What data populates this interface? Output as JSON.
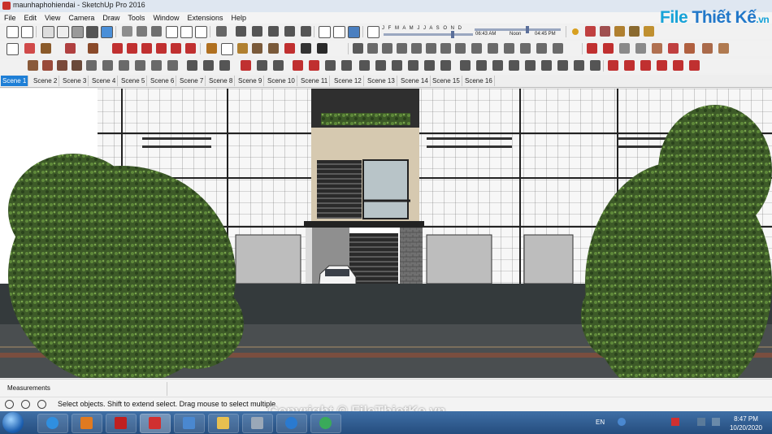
{
  "window": {
    "title": "maunhaphohiendai - SketchUp Pro 2016"
  },
  "menu": [
    "File",
    "Edit",
    "View",
    "Camera",
    "Draw",
    "Tools",
    "Window",
    "Extensions",
    "Help"
  ],
  "shadow_settings": {
    "months": "J F M A M J J A S O N D",
    "time_start": "06:43 AM",
    "time_mid": "Noon",
    "time_end": "04:45 PM",
    "date_fraction": 0.78,
    "time_fraction": 0.62
  },
  "logo": {
    "text_main": "File",
    "text_rest": "Thiết Kế",
    "text_tld": ".vn"
  },
  "scenes": {
    "active": 0,
    "items": [
      "Scene 1",
      "Scene 2",
      "Scene 3",
      "Scene 4",
      "Scene 5",
      "Scene 6",
      "Scene 7",
      "Scene 8",
      "Scene 9",
      "Scene 10",
      "Scene 11",
      "Scene 12",
      "Scene 13",
      "Scene 14",
      "Scene 15",
      "Scene 16"
    ]
  },
  "measurements": {
    "label": "Measurements",
    "value": ""
  },
  "status": {
    "hint": "Select objects. Shift to extend select. Drag mouse to select multiple"
  },
  "watermark": {
    "text": "Copyright © FileThietKe.vn"
  },
  "taskbar": {
    "language": "EN",
    "time": "8:47 PM",
    "date": "10/20/2020"
  },
  "colors": {
    "accent": "#1e7fd6",
    "taskbar": "#2f5d93",
    "logo": "#17a3d8"
  }
}
